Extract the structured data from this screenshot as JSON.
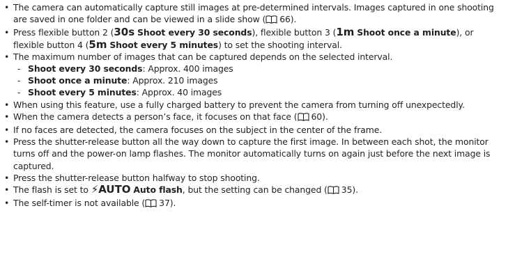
{
  "items": {
    "b1": "The camera can automatically capture still images at pre-determined intervals. Images captured in one shooting are saved in one folder and can be viewed in a slide show (",
    "b1_ref": "66",
    "b1_end": ").",
    "b2": {
      "t1": "Press flexible button 2 (",
      "sym1": "30s",
      "lbl1": "Shoot every 30 seconds",
      "t2": "), flexible button 3 (",
      "sym2": "1m",
      "lbl2": "Shoot once a minute",
      "t3": "), or flexible button 4 (",
      "sym3": "5m",
      "lbl3": "Shoot every 5 minutes",
      "t4": ") to set the shooting interval."
    },
    "b3": "The maximum number of images that can be captured depends on the selected interval.",
    "sub": [
      {
        "label": "Shoot every 30 seconds",
        "text": ": Approx. 400 images"
      },
      {
        "label": "Shoot once a minute",
        "text": ": Approx. 210 images"
      },
      {
        "label": "Shoot every 5 minutes",
        "text": ": Approx. 40 images"
      }
    ],
    "b4": "When using this feature, use a fully charged battery to prevent the camera from turning off unexpectedly.",
    "b5": "When the camera detects a person’s face, it focuses on that face (",
    "b5_ref": "60",
    "b5_end": ").",
    "b6": "If no faces are detected, the camera focuses on the subject in the center of the frame.",
    "b7": "Press the shutter-release button all the way down to capture the first image. In between each shot, the monitor turns off and the power-on lamp flashes. The monitor automatically turns on again just before the next image is captured.",
    "b8": "Press the shutter-release button halfway to stop shooting.",
    "b9": {
      "t1": "The flash is set to ",
      "sym": "⚡AUTO",
      "lbl": "Auto flash",
      "t2": ", but the setting can be changed (",
      "ref": "35",
      "t3": ")."
    },
    "b10": "The self-timer is not available (",
    "b10_ref": "37",
    "b10_end": ")."
  },
  "icons": {
    "reference": "book-reference-icon"
  }
}
